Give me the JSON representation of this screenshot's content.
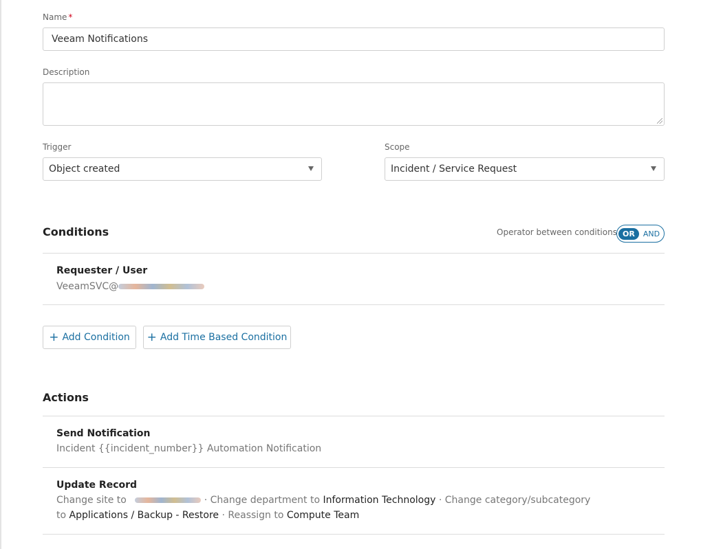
{
  "form": {
    "name_label": "Name",
    "required_mark": "*",
    "name_value": "Veeam Notifications",
    "description_label": "Description",
    "description_value": "",
    "trigger_label": "Trigger",
    "trigger_value": "Object created",
    "scope_label": "Scope",
    "scope_value": "Incident / Service Request"
  },
  "conditions": {
    "title": "Conditions",
    "operator_label": "Operator between conditions",
    "operator_options": [
      "OR",
      "AND"
    ],
    "operator_selected": "OR",
    "items": [
      {
        "title": "Requester / User",
        "value": "VeeamSVC@"
      }
    ],
    "add_condition_label": "Add Condition",
    "add_time_condition_label": "Add Time Based Condition"
  },
  "actions": {
    "title": "Actions",
    "send_notification": {
      "title": "Send Notification",
      "subtitle": "Incident {{incident_number}} Automation Notification"
    },
    "update_record": {
      "title": "Update Record",
      "change_site": "Change site to",
      "sep": "·",
      "change_department": "Change department to",
      "department_value": "Information Technology",
      "change_category": "Change category/subcategory",
      "to": "to",
      "category_value": "Applications / Backup - Restore",
      "reassign": "Reassign to",
      "reassign_value": "Compute Team"
    }
  },
  "colors": {
    "accent": "#1a6fa1",
    "required": "#d0021b",
    "border": "#cfcfcf"
  }
}
